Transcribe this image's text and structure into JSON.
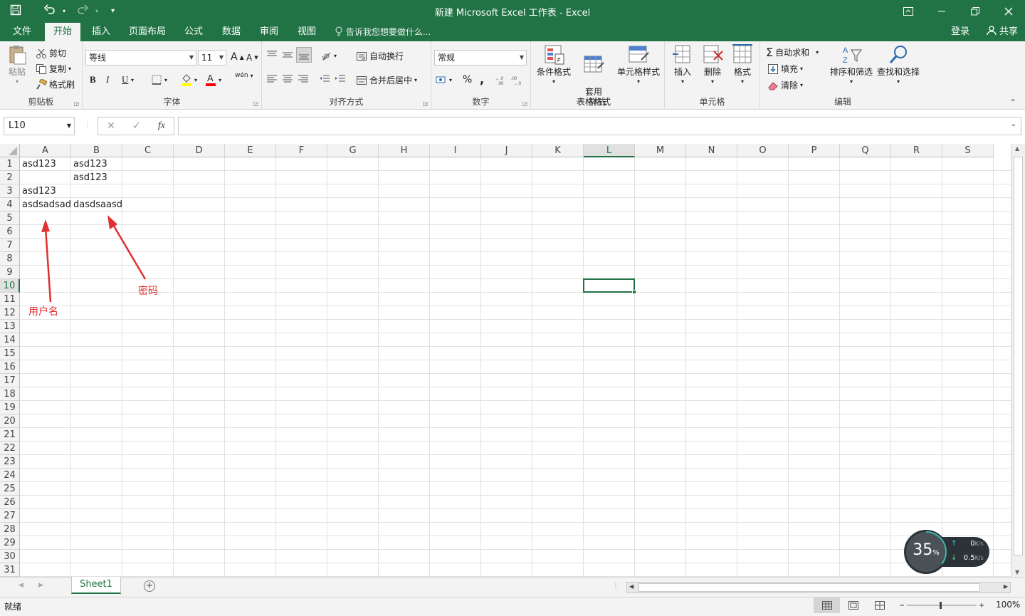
{
  "titlebar": {
    "title": "新建 Microsoft Excel 工作表 - Excel"
  },
  "tabs": [
    {
      "label": "文件"
    },
    {
      "label": "开始"
    },
    {
      "label": "插入"
    },
    {
      "label": "页面布局"
    },
    {
      "label": "公式"
    },
    {
      "label": "数据"
    },
    {
      "label": "审阅"
    },
    {
      "label": "视图"
    }
  ],
  "tellme": "告诉我您想要做什么...",
  "login": "登录",
  "share": "共享",
  "ribbon": {
    "clipboard": {
      "label": "剪贴板",
      "paste": "粘贴",
      "cut": "剪切",
      "copy": "复制",
      "format_painter": "格式刷"
    },
    "font": {
      "label": "字体",
      "font_name": "等线",
      "font_size": "11",
      "bold": "B",
      "italic": "I",
      "underline": "U",
      "wen": "wén"
    },
    "alignment": {
      "label": "对齐方式",
      "wrap": "自动换行",
      "merge": "合并后居中"
    },
    "number": {
      "label": "数字",
      "format": "常规",
      "percent": "%",
      "comma": ","
    },
    "styles": {
      "label": "样式",
      "conditional": "条件格式",
      "table": "套用\n表格格式",
      "cell_styles": "单元格样式"
    },
    "cells": {
      "label": "单元格",
      "insert": "插入",
      "delete": "删除",
      "format": "格式"
    },
    "editing": {
      "label": "编辑",
      "autosum": "自动求和",
      "fill": "填充",
      "clear": "清除",
      "sort": "排序和筛选",
      "find": "查找和选择"
    }
  },
  "formula_bar": {
    "name_box": "L10",
    "fx": "fx",
    "content": ""
  },
  "columns": [
    "A",
    "B",
    "C",
    "D",
    "E",
    "F",
    "G",
    "H",
    "I",
    "J",
    "K",
    "L",
    "M",
    "N",
    "O",
    "P",
    "Q",
    "R",
    "S"
  ],
  "rows": [
    "1",
    "2",
    "3",
    "4",
    "5",
    "6",
    "7",
    "8",
    "9",
    "10",
    "11",
    "12",
    "13",
    "14",
    "15",
    "16",
    "17",
    "18",
    "19",
    "20",
    "21",
    "22",
    "23",
    "24",
    "25",
    "26",
    "27",
    "28",
    "29",
    "30",
    "31"
  ],
  "cells": {
    "A1": "asd123",
    "B1": "asd123",
    "B2": "asd123",
    "A3": "asd123",
    "A4": "asdsadsad",
    "B4": "dasdsaasd"
  },
  "selected_cell": "L10",
  "annotations": {
    "username": "用户名",
    "password": "密码",
    "color": "#e03030"
  },
  "sheets": [
    {
      "name": "Sheet1"
    }
  ],
  "add_sheet": "⊕",
  "status": {
    "ready": "就绪",
    "zoom": "100%"
  },
  "network_widget": {
    "percent": "35",
    "percent_unit": "%",
    "upload": "0",
    "upload_unit": "K/s",
    "download": "0.5",
    "download_unit": "K/s"
  },
  "colors": {
    "accent": "#217346"
  }
}
